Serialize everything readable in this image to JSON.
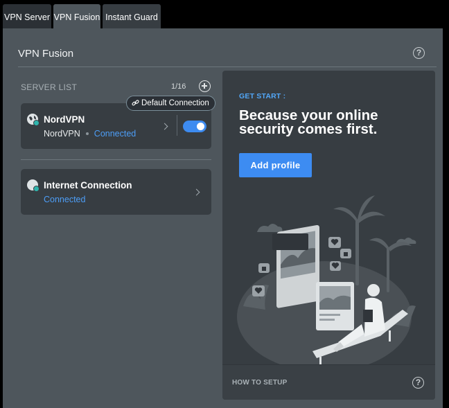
{
  "tabs": [
    {
      "label": "VPN Server",
      "active": false
    },
    {
      "label": "VPN Fusion",
      "active": true
    },
    {
      "label": "Instant Guard",
      "active": false
    }
  ],
  "panel": {
    "title": "VPN Fusion",
    "help_glyph": "?"
  },
  "server_list": {
    "label": "SERVER LIST",
    "count": "1/16",
    "default_tag": "Default Connection",
    "items": [
      {
        "name": "NordVPN",
        "subtitle": "NordVPN",
        "status": "Connected",
        "enabled": true,
        "icon": "globe-vpn-icon"
      },
      {
        "name": "Internet Connection",
        "status": "Connected",
        "icon": "globe-check-icon"
      }
    ]
  },
  "promo": {
    "kicker": "GET START :",
    "headline": "Because your online security comes first.",
    "button_label": "Add profile",
    "footer_label": "HOW TO SETUP",
    "help_glyph": "?"
  },
  "colors": {
    "accent": "#3d8cf2",
    "status": "#4d9ef7",
    "panel_bg": "#4e565c",
    "card_bg": "#373d42"
  }
}
